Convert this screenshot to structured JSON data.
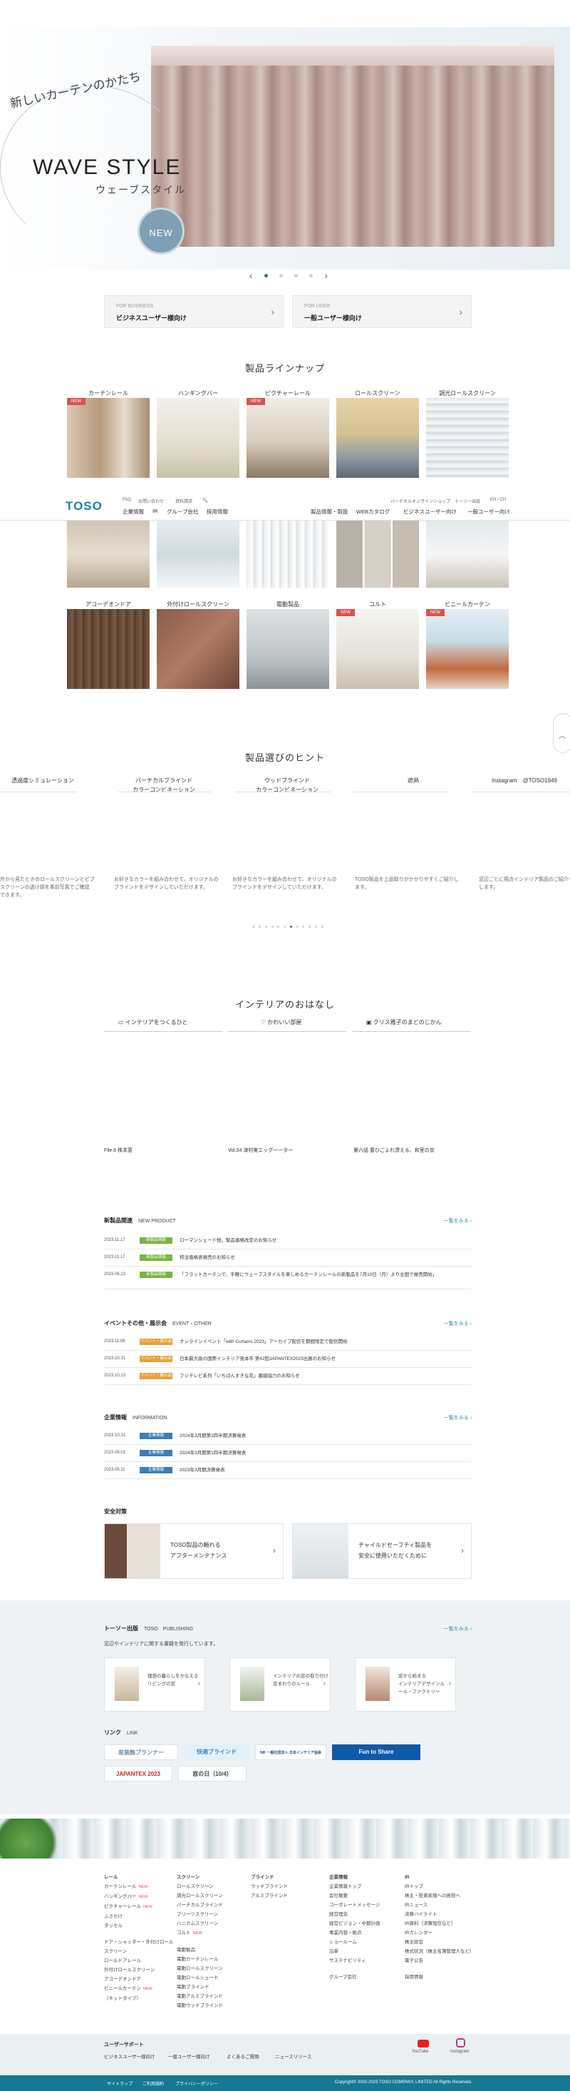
{
  "hero": {
    "script_text": "新しいカーテンのかたち",
    "title": "WAVE STYLE",
    "subtitle": "ウェーブスタイル",
    "badge": "NEW",
    "prev": "‹",
    "next": "›"
  },
  "user_buttons": [
    {
      "caption": "FOR BUSINESS",
      "label": "ビジネスユーザー様向け",
      "chevron": "›"
    },
    {
      "caption": "FOR USER",
      "label": "一般ユーザー様向け",
      "chevron": "›"
    }
  ],
  "products": {
    "title": "製品ラインナップ",
    "row1": [
      {
        "label": "カーテンレール",
        "badge": "NEW"
      },
      {
        "label": "ハンギングバー",
        "badge": ""
      },
      {
        "label": "ピクチャーレール",
        "badge": "NEW"
      },
      {
        "label": "ロールスクリーン",
        "badge": ""
      },
      {
        "label": "調光ロールスクリーン",
        "badge": ""
      }
    ],
    "row3": [
      {
        "label": "アコーデオンドア",
        "badge": ""
      },
      {
        "label": "外付けロールスクリーン",
        "badge": ""
      },
      {
        "label": "電動製品",
        "badge": ""
      },
      {
        "label": "コルト",
        "badge": "NEW"
      },
      {
        "label": "ビニールカーテン",
        "badge": "NEW"
      }
    ]
  },
  "navbar": {
    "logo": "TOSO",
    "top_links": [
      "FAQ",
      "お問い合わせ",
      "資料請求"
    ],
    "search_icon": "🔍",
    "right_top_links": [
      "バーチカルオンラインショップ",
      "トーソー出版",
      "EN / CH"
    ],
    "left_links": [
      "企業情報",
      "IR",
      "グループ会社",
      "採用情報"
    ],
    "right_links": [
      "製品情報・取扱",
      "WEBカタログ",
      "ビジネスユーザー向け",
      "一般ユーザー向け"
    ]
  },
  "hints": {
    "title": "製品選びのヒント",
    "items": [
      "透過度シミュレーション",
      "バーチカルブラインド\nカラーコンビネーション",
      "ウッドブラインド\nカラーコンビネーション",
      "遮熱",
      "Instagram　@TOSO1949"
    ],
    "descs": [
      "外から見たときのロールスクリーンとビブ\nスクリーンの透け感を事前写真でご確認\nできます。",
      "お好きなカラーを組み合わせて、オリジナルの\nブラインドをデザインしていただけます。",
      "お好きなカラーを組み合わせて、オリジナルの\nブラインドをデザインしていただけます。",
      "TOSO製品を上品取りがかかりやすくご紹介し\nます。",
      "窓辺ごとに視点インテリア製品のご紹介を\nします。"
    ],
    "prev": "‹",
    "next": "›"
  },
  "interior": {
    "title": "インテリアのおはなし",
    "tabs": [
      "インテリアをつくるひと",
      "かわいい部屋",
      "クリス雅子のまどのじかん"
    ],
    "stories": [
      "File.6 株本恵",
      "Vol.04 津村実エッグー一ター",
      "第六話 春ひごよれ漂える、和室の京"
    ]
  },
  "news": {
    "new_product": {
      "head": "新製品関連",
      "head_en": "NEW PRODUCT",
      "more": "一覧をみる ›",
      "items": [
        {
          "date": "2023.11.17",
          "tag": "新製品情報",
          "text": "ローマンシェード他、製品価格改定のお知らせ"
        },
        {
          "date": "2023.11.17",
          "tag": "新製品情報",
          "text": "特注価格表発売のお知らせ"
        },
        {
          "date": "2023.06.23",
          "tag": "新製品情報",
          "text": "「フラットカーテンで、手軽にウェーブスタイルを楽しめるカーテンレールの新製品を7月10日（月）より全国で発売開始」"
        }
      ]
    },
    "event": {
      "head": "イベントその他・展示会",
      "head_en": "EVENT・OTHER",
      "more": "一覧をみる ›",
      "items": [
        {
          "date": "2023.11.08",
          "tag": "イベント・展示会",
          "text": "オンラインイベント「with Curtains 2023」アーカイブ配信を期間限定で配信開始"
        },
        {
          "date": "2023.10.31",
          "tag": "イベント・展示会",
          "text": "日本最大級の国際インテリア見本市 第42回JAPANTEX2023出展のお知らせ"
        },
        {
          "date": "2023.10.13",
          "tag": "イベント・展示会",
          "text": "フジテレビ系列「いちばんすきな花」番組協力のお知らせ"
        }
      ]
    },
    "info": {
      "head": "企業情報",
      "head_en": "INFORMATION",
      "more": "一覧をみる ›",
      "items": [
        {
          "date": "2023.10.31",
          "tag": "企業情報",
          "text": "2024年3月期第2四半期決算発表"
        },
        {
          "date": "2023.08.01",
          "tag": "企業情報",
          "text": "2024年3月期第1四半期決算発表"
        },
        {
          "date": "2023.05.11",
          "tag": "企業情報",
          "text": "2023年3月期決算発表"
        }
      ]
    }
  },
  "safety": {
    "title": "安全対策",
    "boxes": [
      {
        "text": "TOSO製品の頼れる\nアフターメンテナンス",
        "chev": "›"
      },
      {
        "text": "チャイルドセーフティ製品を\n安全に使用いただくために",
        "chev": "›"
      }
    ]
  },
  "publishing": {
    "head": "トーソー出版",
    "head_en": "TOSO　PUBLISHING",
    "more": "一覧をみる ›",
    "desc": "窓辺やインテリアに関する書籍を発行しています。",
    "books": [
      {
        "text": "理想の暮らしをかなえる\nリビングの窓",
        "chev": "›"
      },
      {
        "text": "インテリアの窓の取り付け\n窓まわりのルール",
        "chev": "›"
      },
      {
        "text": "窓から始まる\nインテリアデザインル\nール・ファクトリー",
        "chev": "›"
      }
    ]
  },
  "links": {
    "head": "リンク",
    "head_en": "LINK",
    "banners": [
      "窓装飾プランナー",
      "快適ブラインド",
      "NIF 一般社団法人 日本インテリア協会",
      "Fun to Share",
      "JAPANTEX 2023",
      "窓の日（10/4）"
    ]
  },
  "footer": {
    "cols": [
      {
        "items": [
          "レール",
          "カーテンレール",
          "ハンギングバー",
          "ピクチャーレール",
          "ふさかけ",
          "タッセル",
          "",
          "ドア・シャッター・外付けロール",
          "スクリーン",
          "ロールドアレール",
          "外付けロールスクリーン",
          "アコーデオンドア",
          "ビニールカーテン",
          "（キットタイプ）"
        ],
        "new": [
          1,
          2,
          3,
          12
        ]
      },
      {
        "items": [
          "スクリーン",
          "ロールスクリーン",
          "調光ロールスクリーン",
          "バーチカルブラインド",
          "プリーツスクリーン",
          "ハニカムスクリーン",
          "コルト",
          "",
          "電動製品",
          "電動カーテンレール",
          "電動ロールスクリーン",
          "電動ロールシェード",
          "電動ブラインド",
          "電動アルミブラインド",
          "電動ウッドブラインド"
        ],
        "new": [
          6
        ]
      },
      {
        "items": [
          "ブラインド",
          "ウッドブラインド",
          "アルミブラインド"
        ],
        "new": []
      },
      {
        "items": [
          "企業情報",
          "企業情報トップ",
          "会社概要",
          "コーポレートメッセージ",
          "経営理念",
          "経営ビジョン・中期計画",
          "事業内容・拠点",
          "ショールーム",
          "沿革",
          "サステナビリティ",
          "",
          "グループ会社"
        ],
        "new": []
      },
      {
        "items": [
          "IR",
          "IRトップ",
          "株主・投資家様への挨拶へ",
          "IRニュース",
          "決算ハイライト",
          "IR資料（決算短信など）",
          "IRカレンダー",
          "株主総会",
          "株式状況（株主名簿管理人など）",
          "電子公告",
          "",
          "採用情報"
        ],
        "new": []
      }
    ],
    "social": [
      "YouTube",
      "Instagram"
    ]
  },
  "bottom": {
    "support_label": "ユーザーサポート",
    "links": [
      "ビジネスユーザー様向け",
      "一般ユーザー様向け",
      "よくあるご質問",
      "ニュースリリース"
    ],
    "copy_links": [
      "サイトマップ",
      "ご利用規約",
      "プライバシーポリシー"
    ],
    "copyright": "Copyright© 2002-2023 TOSO COMPANY, LIMITED All Rights Reserved."
  }
}
